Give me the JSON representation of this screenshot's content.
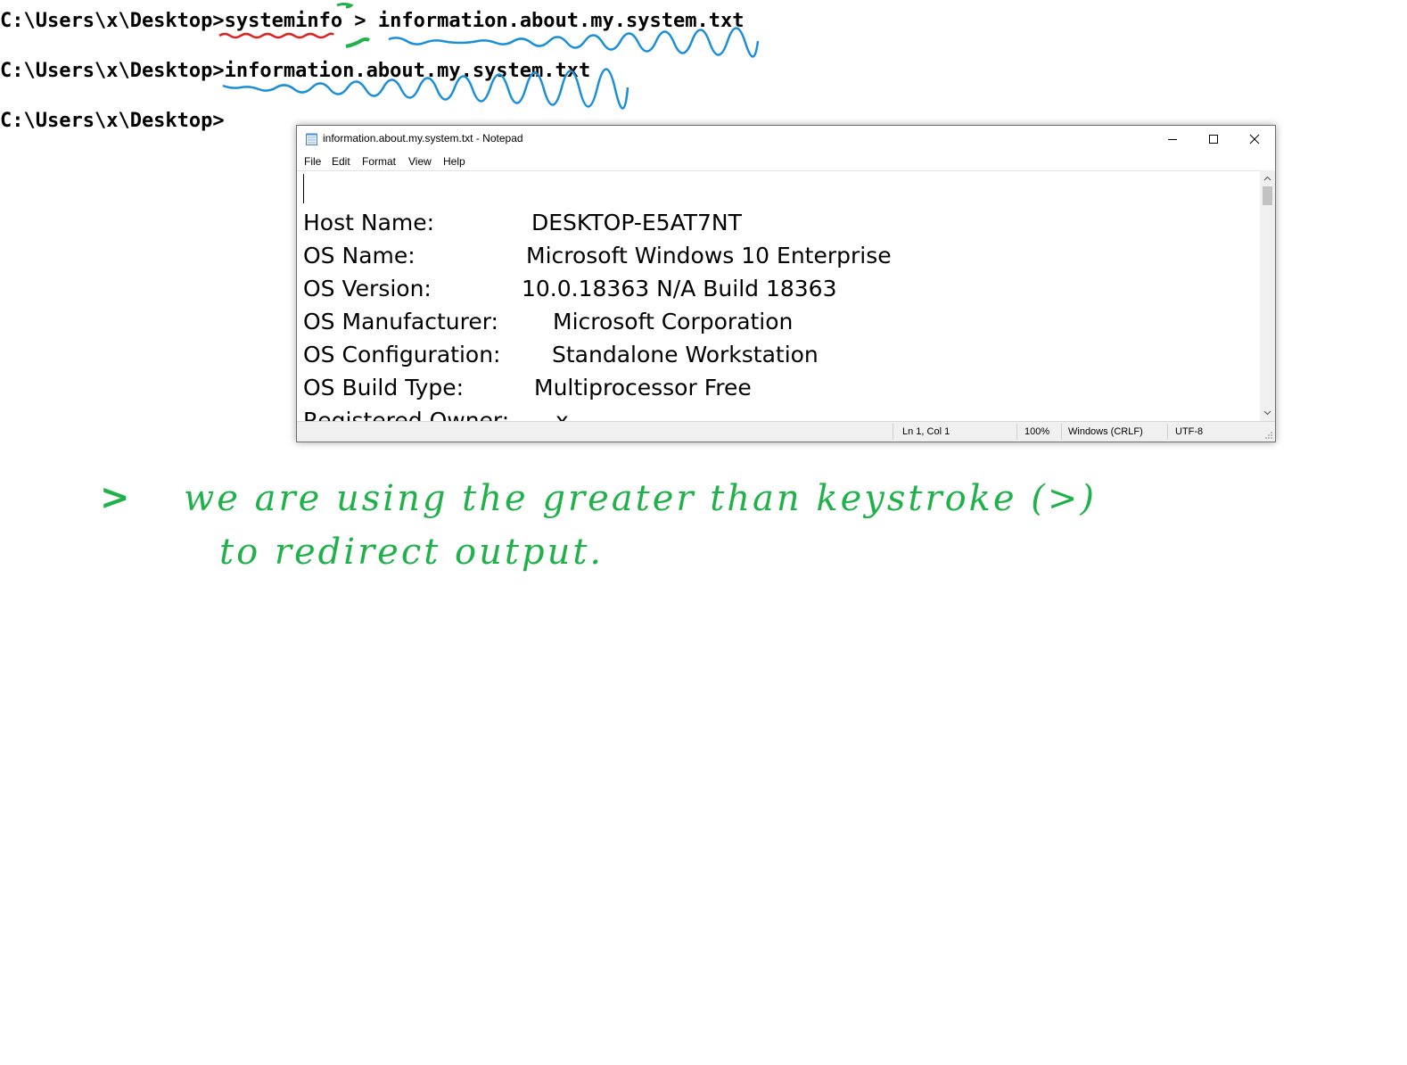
{
  "terminal": {
    "line1_prompt": "C:\\Users\\x\\Desktop>",
    "line1_cmd": "systeminfo",
    "line1_redirect": " > ",
    "line1_file": "information.about.my.system.txt",
    "line2_prompt": "C:\\Users\\x\\Desktop>",
    "line2_cmd": "information.about.my.system.txt",
    "line3_prompt": "C:\\Users\\x\\Desktop>"
  },
  "notepad": {
    "title": "information.about.my.system.txt - Notepad",
    "menu": {
      "file": "File",
      "edit": "Edit",
      "format": "Format",
      "view": "View",
      "help": "Help"
    },
    "rows": [
      {
        "key": "Host Name:",
        "value": "DESKTOP-E5AT7NT"
      },
      {
        "key": "OS Name:",
        "value": "Microsoft Windows 10 Enterprise"
      },
      {
        "key": "OS Version:",
        "value": "10.0.18363 N/A Build 18363"
      },
      {
        "key": "OS Manufacturer:",
        "value": "Microsoft Corporation"
      },
      {
        "key": "OS Configuration:",
        "value": "Standalone Workstation"
      },
      {
        "key": "OS Build Type:",
        "value": "Multiprocessor Free"
      },
      {
        "key": "Registered Owner:",
        "value": "x"
      }
    ],
    "status": {
      "position": "Ln 1, Col 1",
      "zoom": "100%",
      "line_ending": "Windows (CRLF)",
      "encoding": "UTF-8"
    },
    "icons": {
      "title_icon": "notepad-icon",
      "minimize": "minimize-icon",
      "maximize": "maximize-icon",
      "close": "close-icon",
      "scroll_up": "chevron-up-icon",
      "scroll_down": "chevron-down-icon",
      "grip": "resize-grip-icon"
    }
  },
  "annotation": {
    "arrow": ">",
    "line1": "we are using the greater than keystroke (>)",
    "line2": "to redirect output.",
    "color": "#21b14b",
    "underline_red": "#e0201f",
    "underline_blue": "#1a8fd8"
  }
}
